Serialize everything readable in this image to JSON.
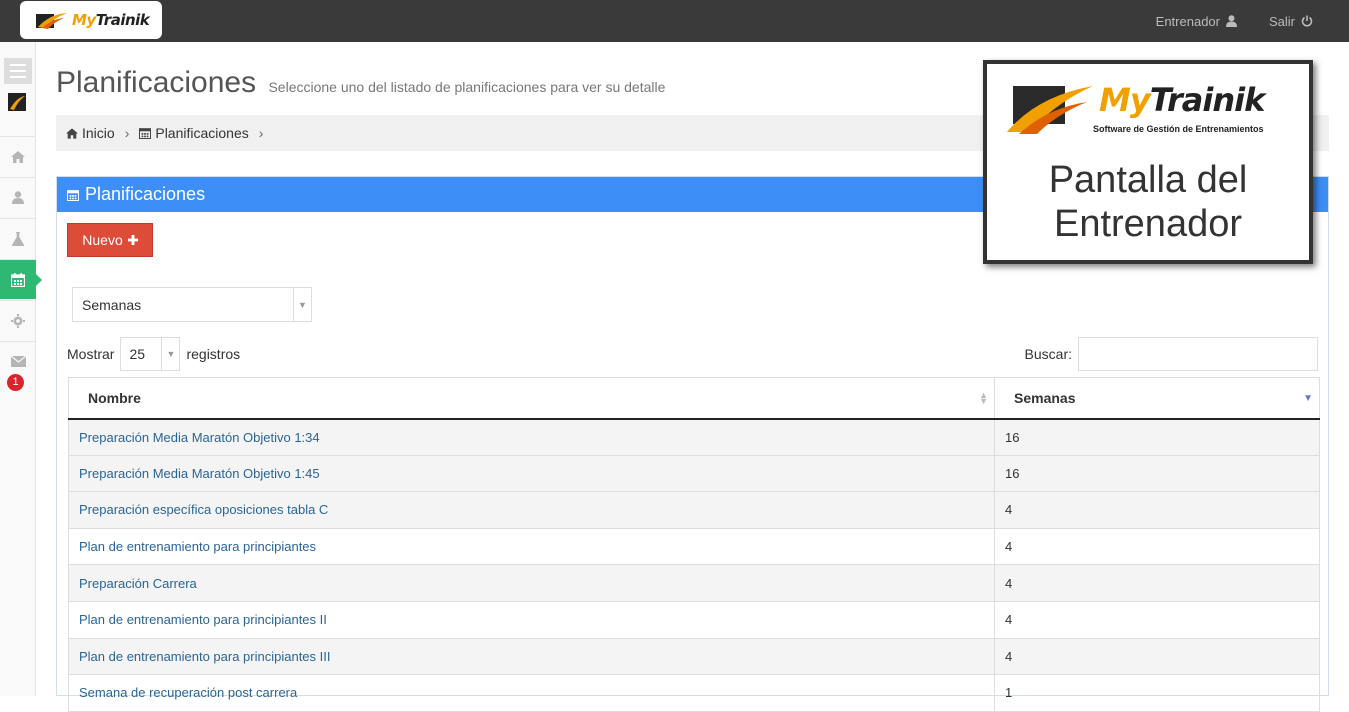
{
  "header": {
    "logo_text_a": "My",
    "logo_text_b": "Trainik",
    "user_label": "Entrenador",
    "logout_label": "Salir"
  },
  "sidebar": {
    "items": [
      {
        "icon": "home-icon"
      },
      {
        "icon": "user-icon"
      },
      {
        "icon": "flask-icon"
      },
      {
        "icon": "calendar-icon",
        "active": true
      },
      {
        "icon": "gear-icon"
      },
      {
        "icon": "envelope-icon"
      }
    ],
    "badge_count": "1"
  },
  "page": {
    "title": "Planificaciones",
    "subtitle": "Seleccione uno del listado de planificaciones para ver su detalle"
  },
  "breadcrumb": {
    "home": "Inicio",
    "current": "Planificaciones"
  },
  "panel": {
    "title": "Planificaciones",
    "new_button": "Nuevo",
    "filter_select": "Semanas",
    "show_label": "Mostrar",
    "page_length": "25",
    "records_label": "registros",
    "search_label": "Buscar:"
  },
  "table": {
    "columns": [
      "Nombre",
      "Semanas"
    ],
    "rows": [
      {
        "name": "Preparación Media Maratón Objetivo 1:34",
        "weeks": "16"
      },
      {
        "name": "Preparación Media Maratón Objetivo 1:45",
        "weeks": "16"
      },
      {
        "name": "Preparación específica oposiciones tabla C",
        "weeks": "4"
      },
      {
        "name": "Plan de entrenamiento para principiantes",
        "weeks": "4"
      },
      {
        "name": "Preparación Carrera",
        "weeks": "4"
      },
      {
        "name": "Plan de entrenamiento para principiantes II",
        "weeks": "4"
      },
      {
        "name": "Plan de entrenamiento para principiantes III",
        "weeks": "4"
      },
      {
        "name": "Semana de recuperación post carrera",
        "weeks": "1"
      }
    ]
  },
  "overlay": {
    "brand_a": "My",
    "brand_b": "Trainik",
    "tagline": "Software de Gestión de Entrenamientos",
    "line1": "Pantalla del",
    "line2": "Entrenador"
  },
  "colors": {
    "topbar": "#3a3a3a",
    "panel_header": "#3e8ef7",
    "new_button": "#dd4b39",
    "sidebar_active": "#2eb872",
    "link": "#2a6496"
  }
}
